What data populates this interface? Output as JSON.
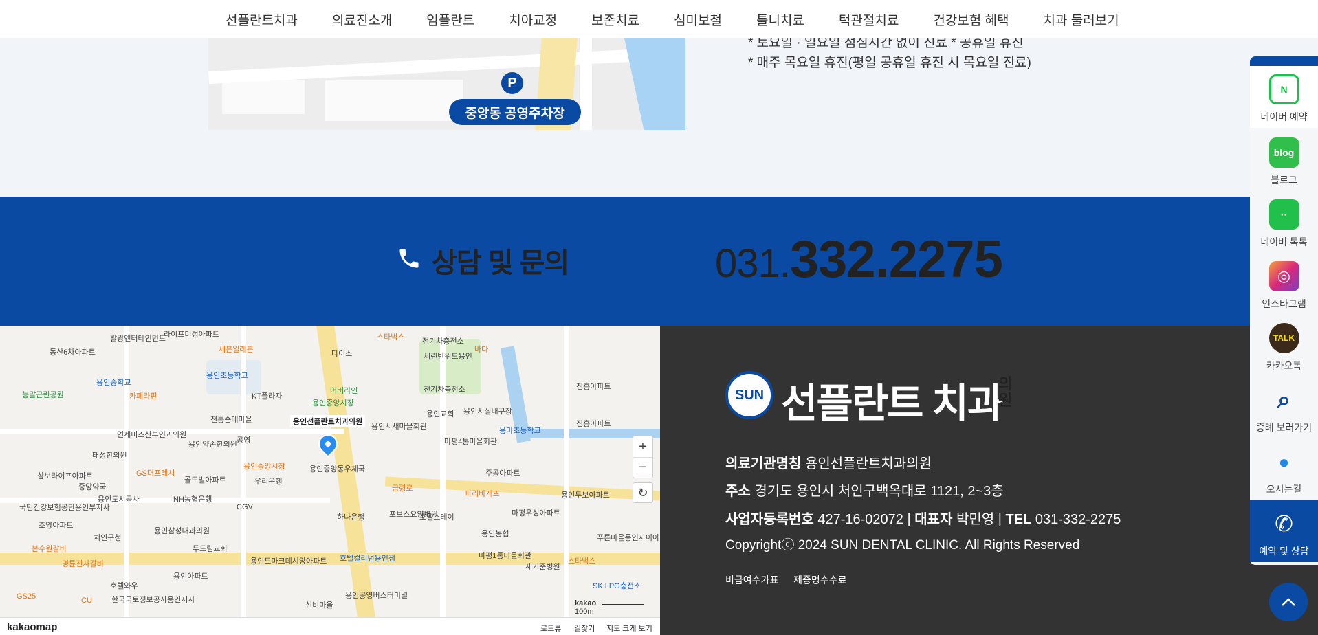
{
  "nav": {
    "items": [
      "선플란트치과",
      "의료진소개",
      "임플란트",
      "치아교정",
      "보존치료",
      "심미보철",
      "틀니치료",
      "턱관절치료",
      "건강보험 혜택",
      "치과 둘러보기"
    ]
  },
  "parking": {
    "label": "중앙동 공영주차장",
    "icon_letter": "P"
  },
  "hours": {
    "line1": "* 토요일 · 일요일 점심시간 없이 진료   * 공휴일 휴진",
    "line2": "* 매주 목요일 휴진(평일 공휴일 휴진 시 목요일 진료)"
  },
  "contact": {
    "title": "상담 및 문의",
    "number_prefix": "031.",
    "number_main": "332.2275"
  },
  "map": {
    "place_name": "용인선플란트치과의원",
    "logo": "kakaomap",
    "scale_label": "kakao",
    "scale_unit": "100m",
    "buttons": [
      "로드뷰",
      "길찾기",
      "지도 크게 보기"
    ],
    "labels": [
      "라이프미성아파트",
      "세븐일레븐",
      "다이소",
      "스타벅스",
      "전기차충전소",
      "바다",
      "용인초등학교",
      "용인중학교",
      "카페라핀",
      "KT플라자",
      "어버라인",
      "용인중앙시장",
      "전통순대마을",
      "연세미즈산부인과의원",
      "용인약손한의원",
      "공영",
      "용인시새마을회관",
      "용인교회",
      "마평4통마을회관",
      "용마초등학교",
      "진흥아파트",
      "태성한의원",
      "GS더프레시",
      "골드빌아파트",
      "우리은행",
      "용인중앙시장",
      "용인중앙동우체국",
      "주공아파트",
      "금령로",
      "파리바게뜨",
      "용인두보아파트",
      "용인도시공사",
      "NH농협은행",
      "CGV",
      "하나은행",
      "포브스요양병원",
      "호텔스테이",
      "마평우성아파트",
      "처인구청",
      "용인삼성내과의원",
      "두드림교회",
      "용인드마크데시앙아파트",
      "호텔컬리넌용인점",
      "용인농협",
      "푸른마을용인자이아파트",
      "명륜진사갈비",
      "본수원갈비",
      "용인아파트",
      "마평1통마을회관",
      "스타벅스",
      "새기준병원",
      "호텔와우",
      "한국국토정보공사용인지사",
      "용인공영버스터미널",
      "SK LPG충전소",
      "선비마을",
      "GS25",
      "CU",
      "삼보라이프아파트",
      "중앙약국",
      "국민건강보험공단용인부지사",
      "진흥아파트",
      "조양아파트",
      "용인시실내구장",
      "전기차충전소",
      "세린반위드용인",
      "동산6차아파트",
      "발광엔터테인먼트",
      "능말근린공원"
    ],
    "zoom_in": "+",
    "zoom_out": "−",
    "reset": "↻"
  },
  "footer": {
    "logo_name": "선플란트 치과",
    "logo_suffix": "의원",
    "logo_badge": "SUN",
    "info": {
      "inst_label": "의료기관명칭",
      "inst_value": "용인선플란트치과의원",
      "addr_label": "주소",
      "addr_value": "경기도 용인시 처인구백옥대로 1121, 2~3층",
      "biz_label": "사업자등록번호",
      "biz_value": "427-16-02072",
      "rep_label": "대표자",
      "rep_value": "박민영",
      "tel_label": "TEL",
      "tel_value": "031-332-2275"
    },
    "copyright": "Copyrightⓒ 2024 SUN DENTAL CLINIC. All Rights Reserved",
    "links": [
      "비급여수가표",
      "제증명수수료"
    ]
  },
  "quick_menu": [
    {
      "label": "네이버 예약",
      "icon": "naver-calendar-icon",
      "color": "#19c34a",
      "glyph": "N"
    },
    {
      "label": "블로그",
      "icon": "blog-icon",
      "color": "#2fbf4a",
      "glyph": "blog"
    },
    {
      "label": "네이버 톡톡",
      "icon": "talktalk-icon",
      "color": "#21c04a",
      "glyph": "··"
    },
    {
      "label": "인스타그램",
      "icon": "instagram-icon",
      "color": "#d6297b",
      "glyph": "◎"
    },
    {
      "label": "카카오톡",
      "icon": "kakaotalk-icon",
      "color": "#3b2a1a",
      "glyph": "TALK"
    },
    {
      "label": "증례 보러가기",
      "icon": "tooth-search-icon",
      "color": "#0b4aa3",
      "glyph": "⌕"
    },
    {
      "label": "오시는길",
      "icon": "location-pin-icon",
      "color": "#1e88e5",
      "glyph": "●"
    },
    {
      "label": "예약 및 상담",
      "icon": "phone-icon",
      "color": "#0b4aa3",
      "glyph": "✆"
    }
  ]
}
